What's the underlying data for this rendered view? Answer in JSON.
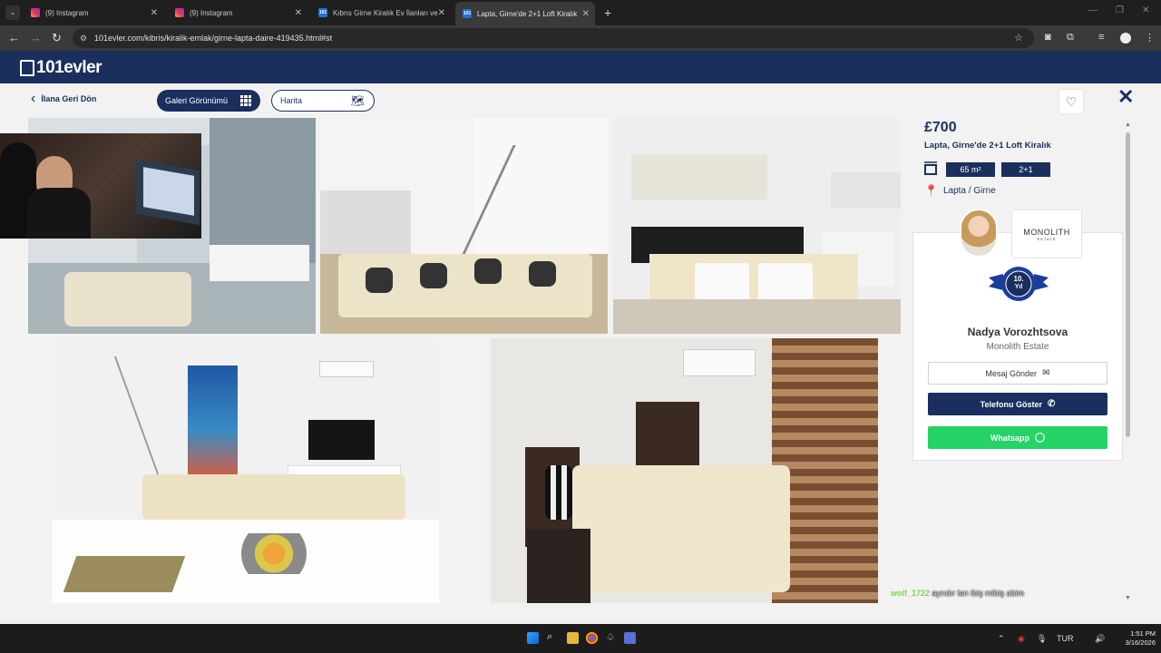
{
  "browser": {
    "tabs": [
      {
        "title": "(9) Instagram",
        "favicon": "instagram-icon",
        "active": false
      },
      {
        "title": "(9) Instagram",
        "favicon": "instagram-icon",
        "active": false
      },
      {
        "title": "Kıbrıs Girne Kiralık Ev İlanları ve",
        "favicon": "101evler-icon",
        "active": false
      },
      {
        "title": "Lapta, Girne'de 2+1 Loft Kiralık",
        "favicon": "101evler-icon",
        "active": true
      }
    ],
    "url": "101evler.com/kibris/kiralik-emlak/girne-lapta-daire-419435.html#st"
  },
  "site": {
    "logo_text": "101evler",
    "brand_color": "#1b2f5e"
  },
  "toolbar": {
    "back_label": "İlana Geri Dön",
    "gallery_label": "Galeri Görünümü",
    "map_label": "Harita"
  },
  "listing": {
    "price": "£700",
    "title": "Lapta, Girne'de 2+1 Loft Kiralık",
    "area": "65 m²",
    "rooms": "2+1",
    "location": "Lapta / Girne"
  },
  "agent": {
    "agency_logo": "MONOLITH",
    "agency_logo_sub": "ESTATE",
    "badge_line1": "10.",
    "badge_line2": "Yıl",
    "name": "Nadya Vorozhtsova",
    "company": "Monolith Estate",
    "message_label": "Mesaj Gönder",
    "phone_label": "Telefonu Göster",
    "whatsapp_label": "Whatsapp"
  },
  "chat": {
    "user": "wolf_1722",
    "message": "ayrıdır lan ibiş mibiş abim"
  },
  "taskbar": {
    "lang": "TUR",
    "time": "1:51 PM",
    "date": "3/16/2026"
  }
}
